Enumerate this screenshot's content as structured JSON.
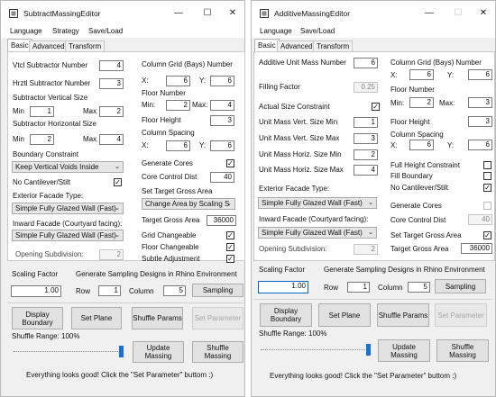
{
  "subtract": {
    "title": "SubtractMassingEditor",
    "controls": {
      "minimize": "—",
      "maximize": "☐",
      "close": "✕"
    },
    "menu": [
      "Language",
      "Strategy",
      "Save/Load"
    ],
    "tabs": [
      "Basic",
      "Advanced",
      "Transform"
    ],
    "left": {
      "vtcl_label": "Vtcl  Subtractor Number",
      "vtcl_value": "4",
      "hrztl_label": "Hrztl Subtractor Number",
      "hrztl_value": "3",
      "vsize_label": "Subtractor Vertical Size",
      "vsize_min_label": "Min",
      "vsize_min": "1",
      "vsize_max_label": "Max",
      "vsize_max": "2",
      "hsize_label": "Subtractor Horizontal Size",
      "hsize_min_label": "Min",
      "hsize_min": "2",
      "hsize_max_label": "Max",
      "hsize_max": "4",
      "boundary_label": "Boundary Constraint",
      "boundary_value": "Keep Vertical Voids Inside",
      "no_cantilever_label": "No Cantilever/Stilt",
      "no_cantilever_checked": "✓",
      "exterior_label": "Exterior Facade Type:",
      "exterior_value": "Simple Fully Glazed Wall (Fast)",
      "inward_label": "Inward Facade (Courtyard facing):",
      "inward_value": "Simple Fully Glazed Wall (Fast)",
      "opening_label": "Opening Subdivision:",
      "opening_value": "2"
    },
    "right": {
      "grid_label": "Column Grid (Bays) Number",
      "grid_x_label": "X:",
      "grid_x": "6",
      "grid_y_label": "Y:",
      "grid_y": "6",
      "floor_number_label": "Floor Number",
      "floor_min_label": "Min:",
      "floor_min": "2",
      "floor_max_label": "Max:",
      "floor_max": "4",
      "floor_height_label": "Floor Height",
      "floor_height": "3",
      "spacing_label": "Column Spacing",
      "spacing_x_label": "X:",
      "spacing_x": "6",
      "spacing_y_label": "Y:",
      "spacing_y": "6",
      "gen_cores_label": "Generate Cores",
      "gen_cores_checked": "✓",
      "core_dist_label": "Core Control Dist",
      "core_dist": "40",
      "target_area_label": "Set Target Gross Area",
      "target_area_mode": "Change Area by Scaling S",
      "target_gross_label": "Target Gross Area",
      "target_gross": "36000",
      "grid_change_label": "Grid Changeable",
      "grid_change_checked": "✓",
      "floor_change_label": "Floor Changeable",
      "floor_change_checked": "✓",
      "subtle_label": "Subtle Adjustment",
      "subtle_checked": "✓"
    },
    "bottom": {
      "scaling_label": "Scaling Factor",
      "scaling_value": "1.00",
      "sampling_title": "Generate Sampling Designs in Rhino Environment",
      "row_label": "Row",
      "row_value": "1",
      "column_label": "Column",
      "column_value": "5",
      "sampling_button": "Sampling",
      "display_boundary": "Display Boundary",
      "set_plane": "Set Plane",
      "shuffle_params": "Shuffle Params",
      "set_parameter": "Set Parameter",
      "shuffle_range_label": "Shuffle Range: 100%",
      "shuffle_range_value": 1.0,
      "update_massing": "Update Massing",
      "shuffle_massing": "Shuffle Massing",
      "status": "Everything looks good! Click the \"Set Parameter\" buttom :)"
    }
  },
  "additive": {
    "title": "AdditiveMassingEditor",
    "controls": {
      "minimize": "—",
      "maximize": "☐",
      "close": "✕"
    },
    "menu": [
      "Language",
      "Save/Load"
    ],
    "tabs": [
      "Basic",
      "Advanced",
      "Transform"
    ],
    "left": {
      "unit_mass_label": "Additive Unit Mass Number",
      "unit_mass_value": "6",
      "filling_label": "Filling Factor",
      "filling_value": "0.25",
      "actual_size_label": "Actual Size Constraint",
      "actual_size_checked": "✓",
      "vmin_label": "Unit Mass Vert. Size Min",
      "vmin_value": "1",
      "vmax_label": "Unit Mass Vert. Size Max",
      "vmax_value": "3",
      "hmin_label": "Unit Mass Horiz. Size Min",
      "hmin_value": "2",
      "hmax_label": "Unit Mass Horiz. Size Max",
      "hmax_value": "4",
      "exterior_label": "Exterior Facade Type:",
      "exterior_value": "Simple Fully Glazed Wall (Fast)",
      "inward_label": "Inward Facade (Courtyard facing):",
      "inward_value": "Simple Fully Glazed Wall (Fast)",
      "opening_label": "Opening Subdivision:",
      "opening_value": "2"
    },
    "right": {
      "grid_label": "Column Grid (Bays) Number",
      "grid_x_label": "X:",
      "grid_x": "6",
      "grid_y_label": "Y:",
      "grid_y": "6",
      "floor_number_label": "Floor Number",
      "floor_min_label": "Min:",
      "floor_min": "2",
      "floor_max_label": "Max:",
      "floor_max": "3",
      "floor_height_label": "Floor Height",
      "floor_height": "3",
      "spacing_label": "Column Spacing",
      "spacing_x_label": "X:",
      "spacing_x": "6",
      "spacing_y_label": "Y:",
      "spacing_y": "6",
      "full_height_label": "Full Height Constraint",
      "fill_boundary_label": "Fill Boundary",
      "no_cantilever_label": "No Cantilever/Stilt",
      "no_cantilever_checked": "✓",
      "gen_cores_label": "Generate Cores",
      "core_dist_label": "Core Control Dist",
      "core_dist": "40",
      "target_area_label": "Set Target Gross Area",
      "target_area_checked": "✓",
      "target_gross_label": "Target Gross Area",
      "target_gross": "36000"
    },
    "bottom": {
      "scaling_label": "Scaling Factor",
      "scaling_value": "1.00",
      "sampling_title": "Generate Sampling Designs in Rhino Environment",
      "row_label": "Row",
      "row_value": "1",
      "column_label": "Column",
      "column_value": "5",
      "sampling_button": "Sampling",
      "display_boundary": "Display Boundary",
      "set_plane": "Set Plane",
      "shuffle_params": "Shuffle Params",
      "set_parameter": "Set Parameter",
      "shuffle_range_label": "Shuffle Range: 100%",
      "shuffle_range_value": 1.0,
      "update_massing": "Update Massing",
      "shuffle_massing": "Shuffle Massing",
      "status": "Everything looks good! Click the \"Set Parameter\" buttom :)"
    }
  },
  "colors": {
    "window_bg": "#f0f0f0",
    "panel_bg": "#ffffff",
    "slider_thumb": "#1a6fd0",
    "focus_border": "#0a64c8"
  }
}
